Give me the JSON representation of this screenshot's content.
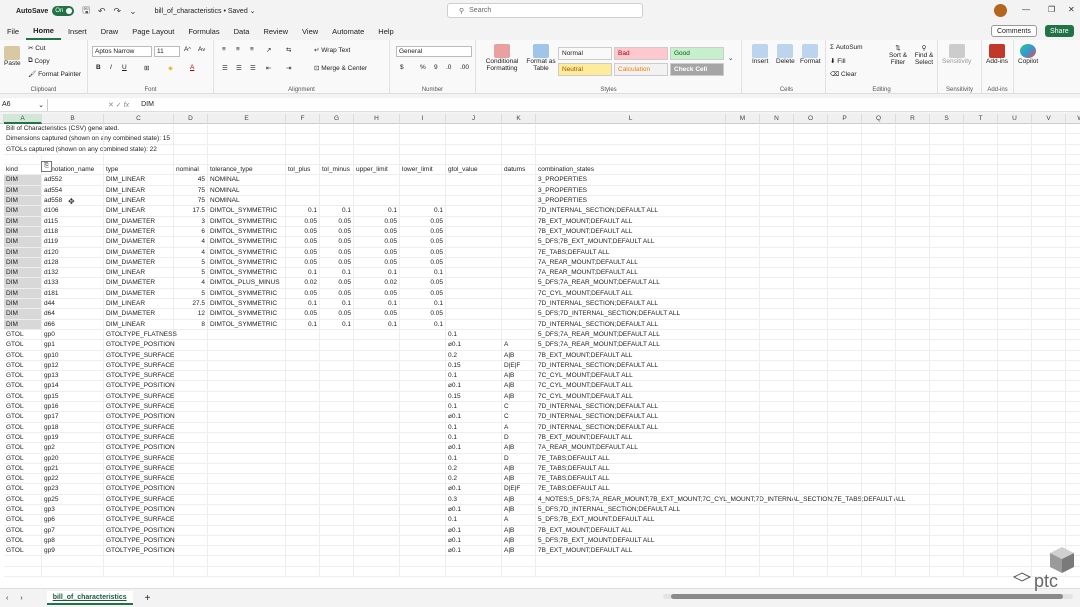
{
  "titlebar": {
    "autosave_label": "AutoSave",
    "autosave_state": "On",
    "doc_title": "bill_of_characteristics • Saved ⌄",
    "search_placeholder": "Search"
  },
  "menu": [
    "File",
    "Home",
    "Insert",
    "Draw",
    "Page Layout",
    "Formulas",
    "Data",
    "Review",
    "View",
    "Automate",
    "Help"
  ],
  "active_menu": "Home",
  "actions": {
    "comments": "Comments",
    "share": "Share"
  },
  "ribbon": {
    "clipboard": {
      "paste": "Paste",
      "cut": "Cut",
      "copy": "Copy",
      "format_painter": "Format Painter",
      "label": "Clipboard"
    },
    "font": {
      "name": "Aptos Narrow",
      "size": "11",
      "label": "Font"
    },
    "alignment": {
      "wrap": "Wrap Text",
      "merge": "Merge & Center",
      "label": "Alignment"
    },
    "number": {
      "format": "General",
      "label": "Number"
    },
    "styles": {
      "conditional": "Conditional Formatting",
      "format_table": "Format as Table",
      "cells": [
        {
          "name": "Normal",
          "bg": "#ffffff",
          "fg": "#000000"
        },
        {
          "name": "Bad",
          "bg": "#ffc7ce",
          "fg": "#9c0006"
        },
        {
          "name": "Good",
          "bg": "#c6efce",
          "fg": "#006100"
        },
        {
          "name": "Neutral",
          "bg": "#ffeb9c",
          "fg": "#9c5700"
        },
        {
          "name": "Calculation",
          "bg": "#f2f2f2",
          "fg": "#fa7d00"
        },
        {
          "name": "Check Cell",
          "bg": "#a5a5a5",
          "fg": "#ffffff"
        }
      ],
      "label": "Styles"
    },
    "cells_group": {
      "insert": "Insert",
      "delete": "Delete",
      "format": "Format",
      "label": "Cells"
    },
    "editing": {
      "autosum": "AutoSum",
      "fill": "Fill",
      "clear": "Clear",
      "sort": "Sort & Filter",
      "find": "Find & Select",
      "label": "Editing"
    },
    "sensitivity": {
      "btn": "Sensitivity",
      "label": "Sensitivity"
    },
    "addins": {
      "btn": "Add-ins",
      "label": "Add-ins"
    },
    "copilot": "Copilot"
  },
  "formula_bar": {
    "name_box": "A6",
    "value": "DIM"
  },
  "columns": [
    "A",
    "B",
    "C",
    "D",
    "E",
    "F",
    "G",
    "H",
    "I",
    "J",
    "K",
    "L",
    "M",
    "N",
    "O",
    "P",
    "Q",
    "R",
    "S",
    "T",
    "U",
    "V",
    "W"
  ],
  "rows": [
    [
      "Bill of Characteristics (CSV) generated."
    ],
    [
      "Dimensions captured (shown on any combined state): 15"
    ],
    [
      "GTOLs captured (shown on any combined state): 22"
    ],
    [],
    [
      "kind",
      "annotation_name",
      "type",
      "nominal",
      "tolerance_type",
      "tol_plus",
      "tol_minus",
      "upper_limit",
      "lower_limit",
      "gtol_value",
      "datums",
      "combination_states"
    ],
    [
      "DIM",
      "ad552",
      "DIM_LINEAR",
      "45",
      "NOMINAL",
      "",
      "",
      "",
      "",
      "",
      "",
      "3_PROPERTIES"
    ],
    [
      "DIM",
      "ad554",
      "DIM_LINEAR",
      "75",
      "NOMINAL",
      "",
      "",
      "",
      "",
      "",
      "",
      "3_PROPERTIES"
    ],
    [
      "DIM",
      "ad558",
      "DIM_LINEAR",
      "75",
      "NOMINAL",
      "",
      "",
      "",
      "",
      "",
      "",
      "3_PROPERTIES"
    ],
    [
      "DIM",
      "d106",
      "DIM_LINEAR",
      "17.5",
      "DIMTOL_SYMMETRIC",
      "0.1",
      "0.1",
      "0.1",
      "0.1",
      "",
      "",
      "7D_INTERNAL_SECTION;DEFAULT ALL"
    ],
    [
      "DIM",
      "d115",
      "DIM_DIAMETER",
      "3",
      "DIMTOL_SYMMETRIC",
      "0.05",
      "0.05",
      "0.05",
      "0.05",
      "",
      "",
      "7B_EXT_MOUNT;DEFAULT ALL"
    ],
    [
      "DIM",
      "d118",
      "DIM_DIAMETER",
      "6",
      "DIMTOL_SYMMETRIC",
      "0.05",
      "0.05",
      "0.05",
      "0.05",
      "",
      "",
      "7B_EXT_MOUNT;DEFAULT ALL"
    ],
    [
      "DIM",
      "d119",
      "DIM_DIAMETER",
      "4",
      "DIMTOL_SYMMETRIC",
      "0.05",
      "0.05",
      "0.05",
      "0.05",
      "",
      "",
      "5_DFS;7B_EXT_MOUNT;DEFAULT ALL"
    ],
    [
      "DIM",
      "d120",
      "DIM_DIAMETER",
      "4",
      "DIMTOL_SYMMETRIC",
      "0.05",
      "0.05",
      "0.05",
      "0.05",
      "",
      "",
      "7E_TABS;DEFAULT ALL"
    ],
    [
      "DIM",
      "d128",
      "DIM_DIAMETER",
      "5",
      "DIMTOL_SYMMETRIC",
      "0.05",
      "0.05",
      "0.05",
      "0.05",
      "",
      "",
      "7A_REAR_MOUNT;DEFAULT ALL"
    ],
    [
      "DIM",
      "d132",
      "DIM_LINEAR",
      "5",
      "DIMTOL_SYMMETRIC",
      "0.1",
      "0.1",
      "0.1",
      "0.1",
      "",
      "",
      "7A_REAR_MOUNT;DEFAULT ALL"
    ],
    [
      "DIM",
      "d133",
      "DIM_DIAMETER",
      "4",
      "DIMTOL_PLUS_MINUS",
      "0.02",
      "0.05",
      "0.02",
      "0.05",
      "",
      "",
      "5_DFS;7A_REAR_MOUNT;DEFAULT ALL"
    ],
    [
      "DIM",
      "d181",
      "DIM_DIAMETER",
      "5",
      "DIMTOL_SYMMETRIC",
      "0.05",
      "0.05",
      "0.05",
      "0.05",
      "",
      "",
      "7C_CYL_MOUNT;DEFAULT ALL"
    ],
    [
      "DIM",
      "d44",
      "DIM_LINEAR",
      "27.5",
      "DIMTOL_SYMMETRIC",
      "0.1",
      "0.1",
      "0.1",
      "0.1",
      "",
      "",
      "7D_INTERNAL_SECTION;DEFAULT ALL"
    ],
    [
      "DIM",
      "d64",
      "DIM_DIAMETER",
      "12",
      "DIMTOL_SYMMETRIC",
      "0.05",
      "0.05",
      "0.05",
      "0.05",
      "",
      "",
      "5_DFS;7D_INTERNAL_SECTION;DEFAULT ALL"
    ],
    [
      "DIM",
      "d66",
      "DIM_LINEAR",
      "8",
      "DIMTOL_SYMMETRIC",
      "0.1",
      "0.1",
      "0.1",
      "0.1",
      "",
      "",
      "7D_INTERNAL_SECTION;DEFAULT ALL"
    ],
    [
      "GTOL",
      "gp0",
      "GTOLTYPE_FLATNESS",
      "",
      "",
      "",
      "",
      "",
      "",
      "0.1",
      "",
      "5_DFS;7A_REAR_MOUNT;DEFAULT ALL"
    ],
    [
      "GTOL",
      "gp1",
      "GTOLTYPE_POSITION",
      "",
      "",
      "",
      "",
      "",
      "",
      "⌀0.1",
      "A",
      "5_DFS;7A_REAR_MOUNT;DEFAULT ALL"
    ],
    [
      "GTOL",
      "gp10",
      "GTOLTYPE_SURFACE",
      "",
      "",
      "",
      "",
      "",
      "",
      "0.2",
      "A|B",
      "7B_EXT_MOUNT;DEFAULT ALL"
    ],
    [
      "GTOL",
      "gp12",
      "GTOLTYPE_SURFACE",
      "",
      "",
      "",
      "",
      "",
      "",
      "0.15",
      "D|E|F",
      "7D_INTERNAL_SECTION;DEFAULT ALL"
    ],
    [
      "GTOL",
      "gp13",
      "GTOLTYPE_SURFACE",
      "",
      "",
      "",
      "",
      "",
      "",
      "0.1",
      "A|B",
      "7C_CYL_MOUNT;DEFAULT ALL"
    ],
    [
      "GTOL",
      "gp14",
      "GTOLTYPE_POSITION",
      "",
      "",
      "",
      "",
      "",
      "",
      "⌀0.1",
      "A|B",
      "7C_CYL_MOUNT;DEFAULT ALL"
    ],
    [
      "GTOL",
      "gp15",
      "GTOLTYPE_SURFACE",
      "",
      "",
      "",
      "",
      "",
      "",
      "0.15",
      "A|B",
      "7C_CYL_MOUNT;DEFAULT ALL"
    ],
    [
      "GTOL",
      "gp16",
      "GTOLTYPE_SURFACE",
      "",
      "",
      "",
      "",
      "",
      "",
      "0.1",
      "C",
      "7D_INTERNAL_SECTION;DEFAULT ALL"
    ],
    [
      "GTOL",
      "gp17",
      "GTOLTYPE_POSITION",
      "",
      "",
      "",
      "",
      "",
      "",
      "⌀0.1",
      "C",
      "7D_INTERNAL_SECTION;DEFAULT ALL"
    ],
    [
      "GTOL",
      "gp18",
      "GTOLTYPE_SURFACE",
      "",
      "",
      "",
      "",
      "",
      "",
      "0.1",
      "A",
      "7D_INTERNAL_SECTION;DEFAULT ALL"
    ],
    [
      "GTOL",
      "gp19",
      "GTOLTYPE_SURFACE",
      "",
      "",
      "",
      "",
      "",
      "",
      "0.1",
      "D",
      "7B_EXT_MOUNT;DEFAULT ALL"
    ],
    [
      "GTOL",
      "gp2",
      "GTOLTYPE_POSITION",
      "",
      "",
      "",
      "",
      "",
      "",
      "⌀0.1",
      "A|B",
      "7A_REAR_MOUNT;DEFAULT ALL"
    ],
    [
      "GTOL",
      "gp20",
      "GTOLTYPE_SURFACE",
      "",
      "",
      "",
      "",
      "",
      "",
      "0.1",
      "D",
      "7E_TABS;DEFAULT ALL"
    ],
    [
      "GTOL",
      "gp21",
      "GTOLTYPE_SURFACE",
      "",
      "",
      "",
      "",
      "",
      "",
      "0.2",
      "A|B",
      "7E_TABS;DEFAULT ALL"
    ],
    [
      "GTOL",
      "gp22",
      "GTOLTYPE_SURFACE",
      "",
      "",
      "",
      "",
      "",
      "",
      "0.2",
      "A|B",
      "7E_TABS;DEFAULT ALL"
    ],
    [
      "GTOL",
      "gp23",
      "GTOLTYPE_POSITION",
      "",
      "",
      "",
      "",
      "",
      "",
      "⌀0.1",
      "D|E|F",
      "7E_TABS;DEFAULT ALL"
    ],
    [
      "GTOL",
      "gp25",
      "GTOLTYPE_SURFACE",
      "",
      "",
      "",
      "",
      "",
      "",
      "0.3",
      "A|B",
      "4_NOTES;5_DFS;7A_REAR_MOUNT;7B_EXT_MOUNT;7C_CYL_MOUNT;7D_INTERNAL_SECTION;7E_TABS;DEFAULT ALL"
    ],
    [
      "GTOL",
      "gp3",
      "GTOLTYPE_POSITION",
      "",
      "",
      "",
      "",
      "",
      "",
      "⌀0.1",
      "A|B",
      "5_DFS;7D_INTERNAL_SECTION;DEFAULT ALL"
    ],
    [
      "GTOL",
      "gp6",
      "GTOLTYPE_SURFACE",
      "",
      "",
      "",
      "",
      "",
      "",
      "0.1",
      "A",
      "5_DFS;7B_EXT_MOUNT;DEFAULT ALL"
    ],
    [
      "GTOL",
      "gp7",
      "GTOLTYPE_POSITION",
      "",
      "",
      "",
      "",
      "",
      "",
      "⌀0.1",
      "A|B",
      "7B_EXT_MOUNT;DEFAULT ALL"
    ],
    [
      "GTOL",
      "gp8",
      "GTOLTYPE_POSITION",
      "",
      "",
      "",
      "",
      "",
      "",
      "⌀0.1",
      "A|B",
      "5_DFS;7B_EXT_MOUNT;DEFAULT ALL"
    ],
    [
      "GTOL",
      "gp9",
      "GTOLTYPE_POSITION",
      "",
      "",
      "",
      "",
      "",
      "",
      "⌀0.1",
      "A|B",
      "7B_EXT_MOUNT;DEFAULT ALL"
    ]
  ],
  "sheet_tab": "bill_of_characteristics",
  "logo_text": "ptc"
}
